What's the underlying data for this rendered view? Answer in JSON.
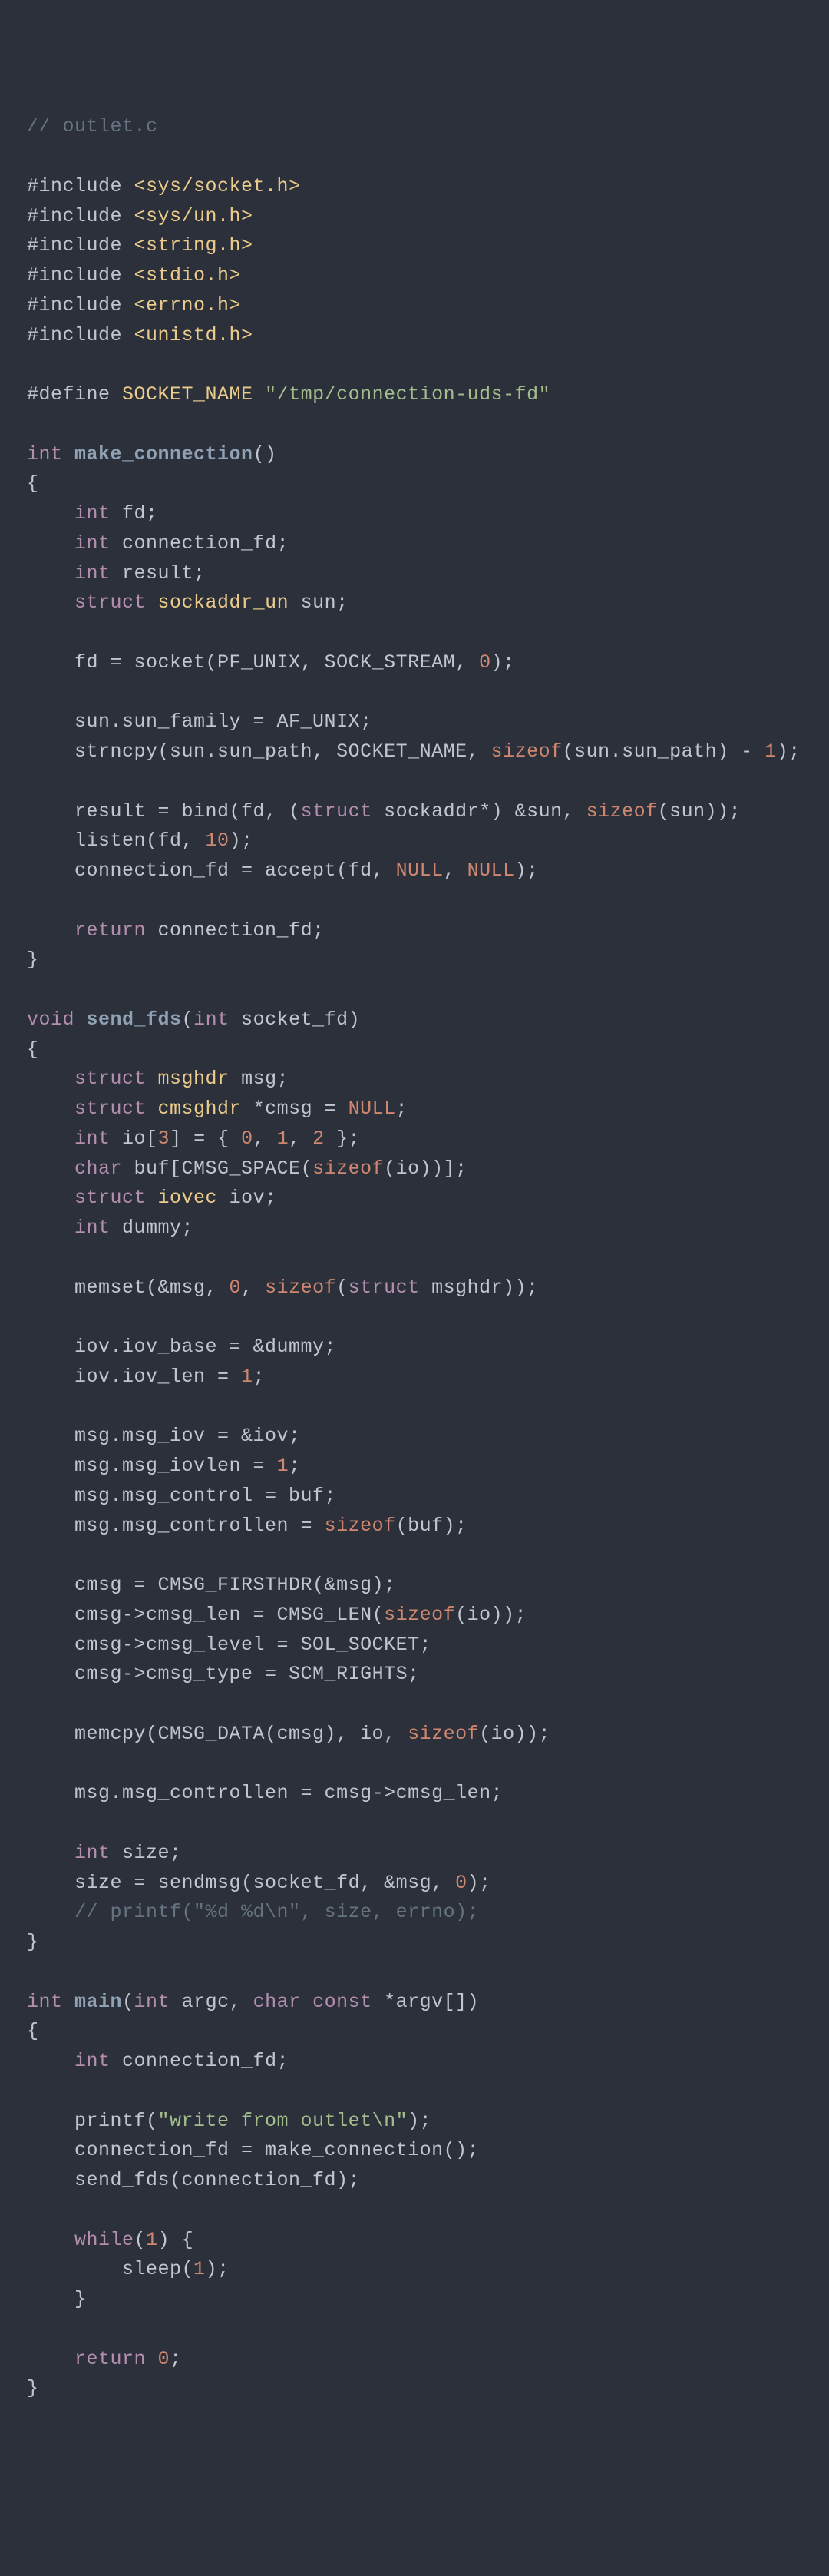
{
  "lines": [
    [
      [
        "cm",
        "// outlet.c"
      ]
    ],
    [],
    [
      [
        "pp",
        "#include "
      ],
      [
        "inc",
        "<sys/socket.h>"
      ]
    ],
    [
      [
        "pp",
        "#include "
      ],
      [
        "inc",
        "<sys/un.h>"
      ]
    ],
    [
      [
        "pp",
        "#include "
      ],
      [
        "inc",
        "<string.h>"
      ]
    ],
    [
      [
        "pp",
        "#include "
      ],
      [
        "inc",
        "<stdio.h>"
      ]
    ],
    [
      [
        "pp",
        "#include "
      ],
      [
        "inc",
        "<errno.h>"
      ]
    ],
    [
      [
        "pp",
        "#include "
      ],
      [
        "inc",
        "<unistd.h>"
      ]
    ],
    [],
    [
      [
        "pp",
        "#define "
      ],
      [
        "ty",
        "SOCKET_NAME "
      ],
      [
        "st",
        "\"/tmp/connection-uds-fd\""
      ]
    ],
    [],
    [
      [
        "kw",
        "int "
      ],
      [
        "fn",
        "make_connection"
      ],
      [
        "op",
        "()"
      ]
    ],
    [
      [
        "op",
        "{"
      ]
    ],
    [
      [
        "nm",
        "    "
      ],
      [
        "kw",
        "int"
      ],
      [
        "nm",
        " fd;"
      ]
    ],
    [
      [
        "nm",
        "    "
      ],
      [
        "kw",
        "int"
      ],
      [
        "nm",
        " connection_fd;"
      ]
    ],
    [
      [
        "nm",
        "    "
      ],
      [
        "kw",
        "int"
      ],
      [
        "nm",
        " result;"
      ]
    ],
    [
      [
        "nm",
        "    "
      ],
      [
        "kw",
        "struct "
      ],
      [
        "ty",
        "sockaddr_un"
      ],
      [
        "nm",
        " sun;"
      ]
    ],
    [],
    [
      [
        "nm",
        "    fd = socket(PF_UNIX, SOCK_STREAM, "
      ],
      [
        "nu",
        "0"
      ],
      [
        "nm",
        ");"
      ]
    ],
    [],
    [
      [
        "nm",
        "    sun.sun_family = AF_UNIX;"
      ]
    ],
    [
      [
        "nm",
        "    strncpy(sun.sun_path, SOCKET_NAME, "
      ],
      [
        "nu",
        "sizeof"
      ],
      [
        "nm",
        "(sun.sun_path) - "
      ],
      [
        "nu",
        "1"
      ],
      [
        "nm",
        ");"
      ]
    ],
    [],
    [
      [
        "nm",
        "    result = bind(fd, ("
      ],
      [
        "kw",
        "struct"
      ],
      [
        "nm",
        " sockaddr*) &sun, "
      ],
      [
        "nu",
        "sizeof"
      ],
      [
        "nm",
        "(sun));"
      ]
    ],
    [
      [
        "nm",
        "    listen(fd, "
      ],
      [
        "nu",
        "10"
      ],
      [
        "nm",
        ");"
      ]
    ],
    [
      [
        "nm",
        "    connection_fd = accept(fd, "
      ],
      [
        "nu",
        "NULL"
      ],
      [
        "nm",
        ", "
      ],
      [
        "nu",
        "NULL"
      ],
      [
        "nm",
        ");"
      ]
    ],
    [],
    [
      [
        "nm",
        "    "
      ],
      [
        "kw",
        "return"
      ],
      [
        "nm",
        " connection_fd;"
      ]
    ],
    [
      [
        "op",
        "}"
      ]
    ],
    [],
    [
      [
        "kw",
        "void "
      ],
      [
        "fn",
        "send_fds"
      ],
      [
        "op",
        "("
      ],
      [
        "kw",
        "int"
      ],
      [
        "nm",
        " socket_fd"
      ],
      [
        "op",
        ")"
      ]
    ],
    [
      [
        "op",
        "{"
      ]
    ],
    [
      [
        "nm",
        "    "
      ],
      [
        "kw",
        "struct "
      ],
      [
        "ty",
        "msghdr"
      ],
      [
        "nm",
        " msg;"
      ]
    ],
    [
      [
        "nm",
        "    "
      ],
      [
        "kw",
        "struct "
      ],
      [
        "ty",
        "cmsghdr"
      ],
      [
        "nm",
        " *cmsg = "
      ],
      [
        "nu",
        "NULL"
      ],
      [
        "nm",
        ";"
      ]
    ],
    [
      [
        "nm",
        "    "
      ],
      [
        "kw",
        "int"
      ],
      [
        "nm",
        " io["
      ],
      [
        "nu",
        "3"
      ],
      [
        "nm",
        "] = { "
      ],
      [
        "nu",
        "0"
      ],
      [
        "nm",
        ", "
      ],
      [
        "nu",
        "1"
      ],
      [
        "nm",
        ", "
      ],
      [
        "nu",
        "2"
      ],
      [
        "nm",
        " };"
      ]
    ],
    [
      [
        "nm",
        "    "
      ],
      [
        "kw",
        "char"
      ],
      [
        "nm",
        " buf[CMSG_SPACE("
      ],
      [
        "nu",
        "sizeof"
      ],
      [
        "nm",
        "(io))];"
      ]
    ],
    [
      [
        "nm",
        "    "
      ],
      [
        "kw",
        "struct "
      ],
      [
        "ty",
        "iovec"
      ],
      [
        "nm",
        " iov;"
      ]
    ],
    [
      [
        "nm",
        "    "
      ],
      [
        "kw",
        "int"
      ],
      [
        "nm",
        " dummy;"
      ]
    ],
    [],
    [
      [
        "nm",
        "    memset(&msg, "
      ],
      [
        "nu",
        "0"
      ],
      [
        "nm",
        ", "
      ],
      [
        "nu",
        "sizeof"
      ],
      [
        "nm",
        "("
      ],
      [
        "kw",
        "struct"
      ],
      [
        "nm",
        " msghdr));"
      ]
    ],
    [],
    [
      [
        "nm",
        "    iov.iov_base = &dummy;"
      ]
    ],
    [
      [
        "nm",
        "    iov.iov_len = "
      ],
      [
        "nu",
        "1"
      ],
      [
        "nm",
        ";"
      ]
    ],
    [],
    [
      [
        "nm",
        "    msg.msg_iov = &iov;"
      ]
    ],
    [
      [
        "nm",
        "    msg.msg_iovlen = "
      ],
      [
        "nu",
        "1"
      ],
      [
        "nm",
        ";"
      ]
    ],
    [
      [
        "nm",
        "    msg.msg_control = buf;"
      ]
    ],
    [
      [
        "nm",
        "    msg.msg_controllen = "
      ],
      [
        "nu",
        "sizeof"
      ],
      [
        "nm",
        "(buf);"
      ]
    ],
    [],
    [
      [
        "nm",
        "    cmsg = CMSG_FIRSTHDR(&msg);"
      ]
    ],
    [
      [
        "nm",
        "    cmsg->cmsg_len = CMSG_LEN("
      ],
      [
        "nu",
        "sizeof"
      ],
      [
        "nm",
        "(io));"
      ]
    ],
    [
      [
        "nm",
        "    cmsg->cmsg_level = SOL_SOCKET;"
      ]
    ],
    [
      [
        "nm",
        "    cmsg->cmsg_type = SCM_RIGHTS;"
      ]
    ],
    [],
    [
      [
        "nm",
        "    memcpy(CMSG_DATA(cmsg), io, "
      ],
      [
        "nu",
        "sizeof"
      ],
      [
        "nm",
        "(io));"
      ]
    ],
    [],
    [
      [
        "nm",
        "    msg.msg_controllen = cmsg->cmsg_len;"
      ]
    ],
    [],
    [
      [
        "nm",
        "    "
      ],
      [
        "kw",
        "int"
      ],
      [
        "nm",
        " size;"
      ]
    ],
    [
      [
        "nm",
        "    size = sendmsg(socket_fd, &msg, "
      ],
      [
        "nu",
        "0"
      ],
      [
        "nm",
        ");"
      ]
    ],
    [
      [
        "nm",
        "    "
      ],
      [
        "cm",
        "// printf(\"%d %d\\n\", size, errno);"
      ]
    ],
    [
      [
        "op",
        "}"
      ]
    ],
    [],
    [
      [
        "kw",
        "int "
      ],
      [
        "fn",
        "main"
      ],
      [
        "op",
        "("
      ],
      [
        "kw",
        "int"
      ],
      [
        "nm",
        " argc, "
      ],
      [
        "kw",
        "char const"
      ],
      [
        "nm",
        " *argv[]"
      ],
      [
        "op",
        ")"
      ]
    ],
    [
      [
        "op",
        "{"
      ]
    ],
    [
      [
        "nm",
        "    "
      ],
      [
        "kw",
        "int"
      ],
      [
        "nm",
        " connection_fd;"
      ]
    ],
    [],
    [
      [
        "nm",
        "    printf("
      ],
      [
        "st",
        "\"write from outlet\\n\""
      ],
      [
        "nm",
        ");"
      ]
    ],
    [
      [
        "nm",
        "    connection_fd = make_connection();"
      ]
    ],
    [
      [
        "nm",
        "    send_fds(connection_fd);"
      ]
    ],
    [],
    [
      [
        "nm",
        "    "
      ],
      [
        "kw",
        "while"
      ],
      [
        "nm",
        "("
      ],
      [
        "nu",
        "1"
      ],
      [
        "nm",
        ") {"
      ]
    ],
    [
      [
        "nm",
        "        sleep("
      ],
      [
        "nu",
        "1"
      ],
      [
        "nm",
        ");"
      ]
    ],
    [
      [
        "nm",
        "    }"
      ]
    ],
    [],
    [
      [
        "nm",
        "    "
      ],
      [
        "kw",
        "return "
      ],
      [
        "nu",
        "0"
      ],
      [
        "nm",
        ";"
      ]
    ],
    [
      [
        "op",
        "}"
      ]
    ]
  ]
}
